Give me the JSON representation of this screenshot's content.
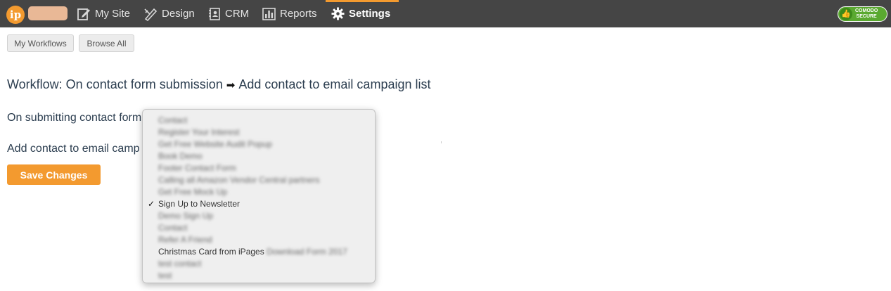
{
  "nav": {
    "logo": "ip",
    "items": [
      {
        "label": "My Site",
        "icon": "edit-page-icon"
      },
      {
        "label": "Design",
        "icon": "design-tools-icon"
      },
      {
        "label": "CRM",
        "icon": "address-book-icon"
      },
      {
        "label": "Reports",
        "icon": "bar-chart-icon"
      },
      {
        "label": "Settings",
        "icon": "gear-icon",
        "active": true
      }
    ],
    "badge_line1": "COMODO",
    "badge_line2": "SECURE"
  },
  "subnav": {
    "my_workflows": "My Workflows",
    "browse_all": "Browse All"
  },
  "workflow": {
    "prefix": "Workflow: On contact form submission",
    "arrow": "➡",
    "suffix": "Add contact to email campaign list"
  },
  "form": {
    "submitting_label": "On submitting contact form",
    "add_contact_label": "Add contact to email camp",
    "save_label": "Save Changes"
  },
  "dropdown": {
    "selected_index": 7,
    "options": [
      {
        "text": "Contact",
        "blurred": true
      },
      {
        "text": "Register Your Interest",
        "blurred": true
      },
      {
        "text": "Get Free Website Audit Popup",
        "blurred": true
      },
      {
        "text": "Book Demo",
        "blurred": true
      },
      {
        "text": "Footer Contact Form",
        "blurred": true
      },
      {
        "text": "Calling all Amazon Vendor Central partners",
        "blurred": true
      },
      {
        "text": "Get Free Mock Up",
        "blurred": true
      },
      {
        "text": "Sign Up to Newsletter",
        "blurred": false
      },
      {
        "text": "Demo Sign Up",
        "blurred": true
      },
      {
        "text": "Contact",
        "blurred": true
      },
      {
        "text": "Refer A Friend",
        "blurred": true
      },
      {
        "text": "Christmas Card from iPages",
        "tail": "Download Form 2017",
        "blurred": false
      },
      {
        "text": "test contact",
        "blurred": true
      },
      {
        "text": "test",
        "blurred": true
      }
    ]
  }
}
